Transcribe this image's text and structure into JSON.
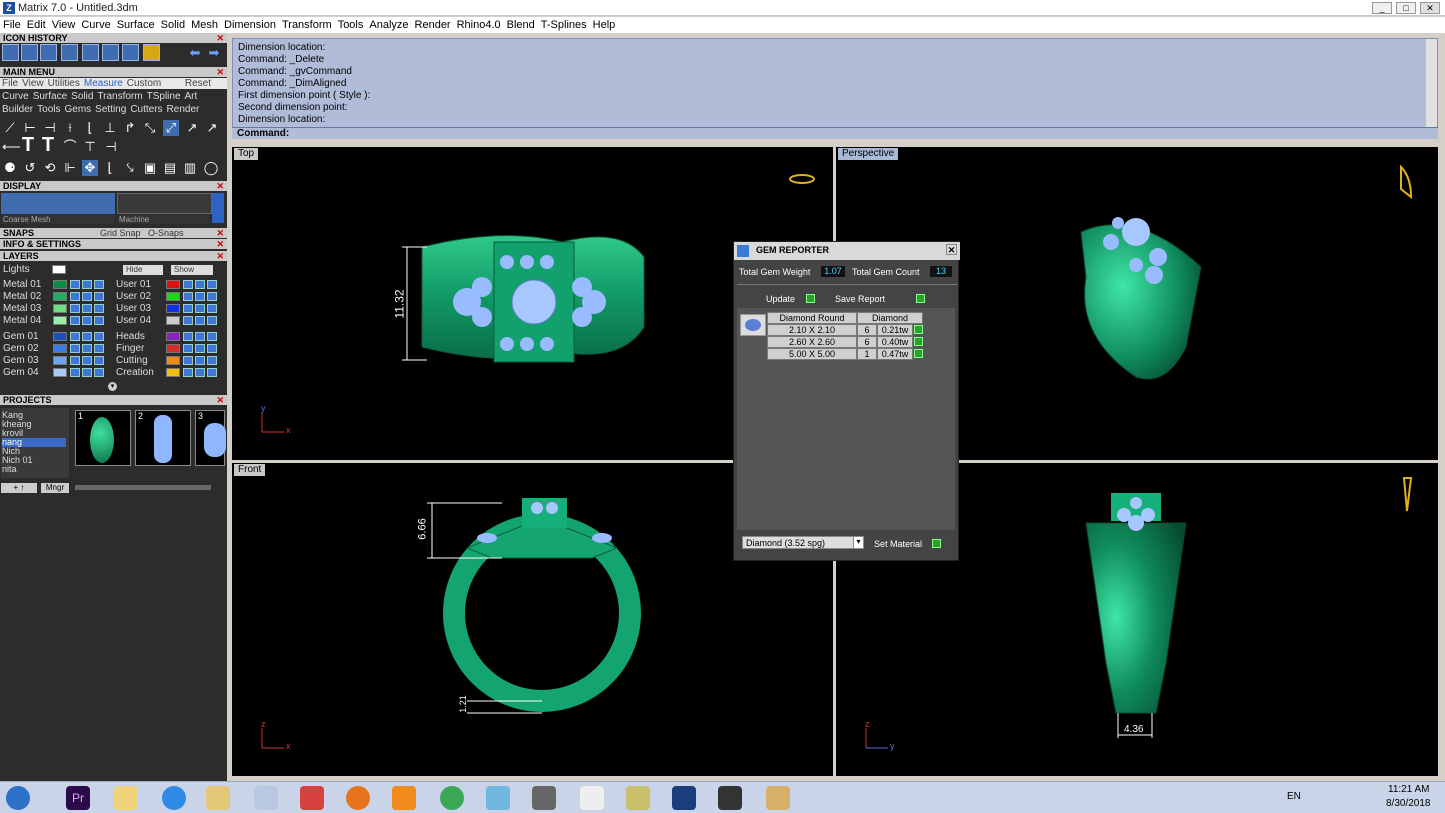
{
  "window": {
    "title": "Matrix 7.0 - Untitled.3dm",
    "logo": "Z",
    "controls": [
      "_",
      "□",
      "✕"
    ]
  },
  "menu": [
    "File",
    "Edit",
    "View",
    "Curve",
    "Surface",
    "Solid",
    "Mesh",
    "Dimension",
    "Transform",
    "Tools",
    "Analyze",
    "Render",
    "Rhino4.0",
    "Blend",
    "T-Splines",
    "Help"
  ],
  "left": {
    "icon_history": "ICON HISTORY",
    "main_menu": "MAIN MENU",
    "tabs": [
      "File",
      "View",
      "Utilities",
      "Measure",
      "Custom"
    ],
    "reset": "Reset",
    "row1": [
      "Curve",
      "Surface",
      "Solid",
      "Transform",
      "TSpline",
      "Art"
    ],
    "row2": [
      "Builder",
      "Tools",
      "Gems",
      "Setting",
      "Cutters",
      "Render"
    ],
    "display": "DISPLAY",
    "display_mode": "Coarse Mesh",
    "display_material": "Machine",
    "snaps": "SNAPS",
    "grid_snap": "Grid Snap",
    "osnaps": "O-Snaps",
    "info": "INFO & SETTINGS",
    "layers": "LAYERS",
    "lights": "Lights",
    "hide": "Hide",
    "show": "Show",
    "layer_left": [
      {
        "name": "Metal 01",
        "color": "#0c8a48"
      },
      {
        "name": "Metal 02",
        "color": "#1fae64"
      },
      {
        "name": "Metal 03",
        "color": "#6adf7e"
      },
      {
        "name": "Metal 04",
        "color": "#98f0a8"
      },
      {
        "name": "Gem 01",
        "color": "#1e4ebc"
      },
      {
        "name": "Gem 02",
        "color": "#3b78e8"
      },
      {
        "name": "Gem 03",
        "color": "#6fa4f0"
      },
      {
        "name": "Gem 04",
        "color": "#a9c8f6"
      }
    ],
    "layer_right": [
      {
        "name": "User 01",
        "color": "#e01010"
      },
      {
        "name": "User 02",
        "color": "#18d818"
      },
      {
        "name": "User 03",
        "color": "#1030e8"
      },
      {
        "name": "User 04",
        "color": "#cccccc"
      },
      {
        "name": "Heads",
        "color": "#8a20c0"
      },
      {
        "name": "Finger",
        "color": "#d22c2c"
      },
      {
        "name": "Cutting",
        "color": "#f08a10"
      },
      {
        "name": "Creation",
        "color": "#f0c010"
      }
    ],
    "projects": "PROJECTS",
    "project_list": [
      "Kang",
      "kheang",
      "krovil",
      "nang",
      "Nich",
      "Nich 01",
      "nita"
    ],
    "selected_project": "nang",
    "thumb_numbers": [
      "1",
      "2",
      "3"
    ],
    "mngr": "Mngr"
  },
  "command": {
    "lines": [
      "Dimension location:",
      "Command: _Delete",
      "Command: _gvCommand",
      "Command: _DimAligned",
      "First dimension point ( Style ):",
      "Second dimension point:",
      "Dimension location:"
    ],
    "prompt": "Command:"
  },
  "viewports": {
    "top": {
      "label": "Top",
      "dim": "11.32",
      "axis_y": "y",
      "axis_x": "x"
    },
    "perspective": {
      "label": "Perspective"
    },
    "front": {
      "label": "Front",
      "dim_a": "6.66",
      "dim_b": "1.21",
      "axis_z": "z",
      "axis_x": "x"
    },
    "right": {
      "dim": "4.36",
      "axis_z": "z",
      "axis_y": "y"
    }
  },
  "gem_reporter": {
    "title": "GEM REPORTER",
    "total_weight_label": "Total Gem Weight",
    "total_weight": "1.07",
    "total_count_label": "Total Gem Count",
    "total_count": "13",
    "update": "Update",
    "save_report": "Save Report",
    "col_shape": "Diamond Round",
    "col_material": "Diamond",
    "rows": [
      {
        "size": "2.10 X 2.10",
        "count": "6",
        "tw": "0.21tw"
      },
      {
        "size": "2.60 X 2.60",
        "count": "6",
        "tw": "0.40tw"
      },
      {
        "size": "5.00 X 5.00",
        "count": "1",
        "tw": "0.47tw"
      }
    ],
    "material_select": "Diamond     (3.52 spg)",
    "set_material": "Set Material"
  },
  "taskbar": {
    "lang": "EN",
    "time": "11:21 AM",
    "date": "8/30/2018"
  },
  "colors": {
    "metal": "#1fa06a",
    "gem": "#9cc4ff",
    "panel": "#2c2c2c",
    "cmd_bg": "#b1bcd9"
  }
}
